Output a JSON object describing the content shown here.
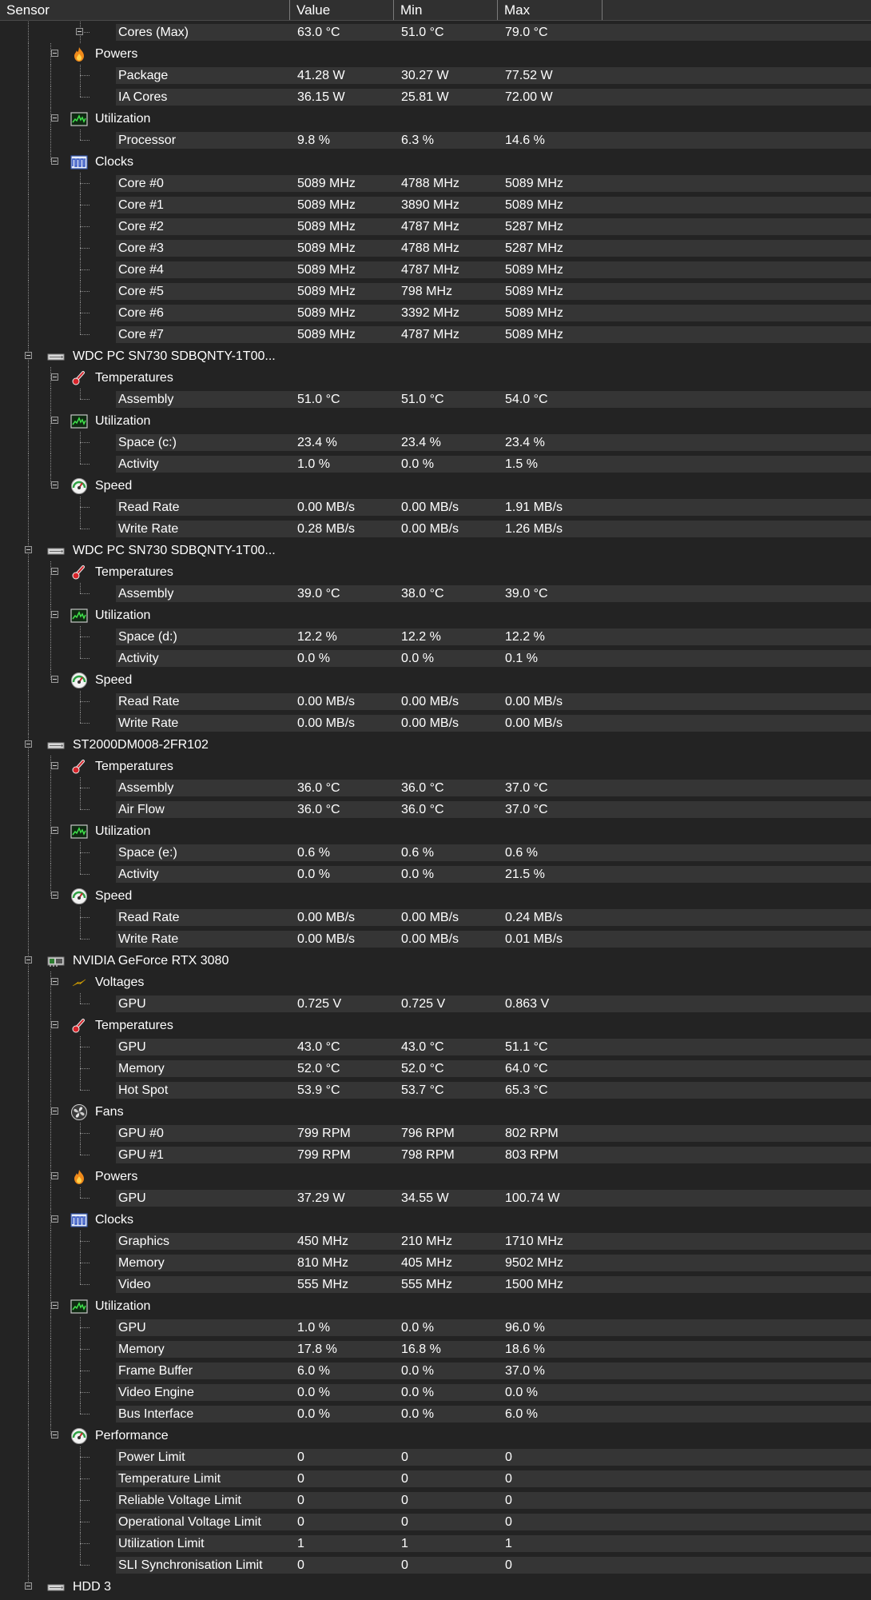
{
  "header": {
    "columns": [
      "Sensor",
      "Value",
      "Min",
      "Max"
    ]
  },
  "rows": [
    {
      "level": 3,
      "label": "Cores (Max)",
      "value": "63.0 °C",
      "min": "51.0 °C",
      "max": "79.0 °C",
      "box": true
    },
    {
      "level": 2,
      "label": "Powers",
      "icon": "flame",
      "last": false
    },
    {
      "level": 3,
      "label": "Package",
      "value": "41.28 W",
      "min": "30.27 W",
      "max": "77.52 W"
    },
    {
      "level": 3,
      "label": "IA Cores",
      "value": "36.15 W",
      "min": "25.81 W",
      "max": "72.00 W",
      "last": true
    },
    {
      "level": 2,
      "label": "Utilization",
      "icon": "util"
    },
    {
      "level": 3,
      "label": "Processor",
      "value": "9.8 %",
      "min": "6.3 %",
      "max": "14.6 %",
      "last": true
    },
    {
      "level": 2,
      "label": "Clocks",
      "icon": "clock",
      "last": true
    },
    {
      "level": 3,
      "label": "Core #0",
      "value": "5089 MHz",
      "min": "4788 MHz",
      "max": "5089 MHz"
    },
    {
      "level": 3,
      "label": "Core #1",
      "value": "5089 MHz",
      "min": "3890 MHz",
      "max": "5089 MHz"
    },
    {
      "level": 3,
      "label": "Core #2",
      "value": "5089 MHz",
      "min": "4787 MHz",
      "max": "5287 MHz"
    },
    {
      "level": 3,
      "label": "Core #3",
      "value": "5089 MHz",
      "min": "4788 MHz",
      "max": "5287 MHz"
    },
    {
      "level": 3,
      "label": "Core #4",
      "value": "5089 MHz",
      "min": "4787 MHz",
      "max": "5089 MHz"
    },
    {
      "level": 3,
      "label": "Core #5",
      "value": "5089 MHz",
      "min": "798 MHz",
      "max": "5089 MHz"
    },
    {
      "level": 3,
      "label": "Core #6",
      "value": "5089 MHz",
      "min": "3392 MHz",
      "max": "5089 MHz"
    },
    {
      "level": 3,
      "label": "Core #7",
      "value": "5089 MHz",
      "min": "4787 MHz",
      "max": "5089 MHz",
      "last": true
    },
    {
      "level": 1,
      "label": "WDC PC SN730 SDBQNTY-1T00...",
      "icon": "drive"
    },
    {
      "level": 2,
      "label": "Temperatures",
      "icon": "thermo"
    },
    {
      "level": 3,
      "label": "Assembly",
      "value": "51.0 °C",
      "min": "51.0 °C",
      "max": "54.0 °C",
      "last": true
    },
    {
      "level": 2,
      "label": "Utilization",
      "icon": "util"
    },
    {
      "level": 3,
      "label": "Space (c:)",
      "value": "23.4 %",
      "min": "23.4 %",
      "max": "23.4 %"
    },
    {
      "level": 3,
      "label": "Activity",
      "value": "1.0 %",
      "min": "0.0 %",
      "max": "1.5 %",
      "last": true
    },
    {
      "level": 2,
      "label": "Speed",
      "icon": "gauge",
      "last": true
    },
    {
      "level": 3,
      "label": "Read Rate",
      "value": "0.00 MB/s",
      "min": "0.00 MB/s",
      "max": "1.91 MB/s"
    },
    {
      "level": 3,
      "label": "Write Rate",
      "value": "0.28 MB/s",
      "min": "0.00 MB/s",
      "max": "1.26 MB/s",
      "last": true
    },
    {
      "level": 1,
      "label": "WDC PC SN730 SDBQNTY-1T00...",
      "icon": "drive"
    },
    {
      "level": 2,
      "label": "Temperatures",
      "icon": "thermo"
    },
    {
      "level": 3,
      "label": "Assembly",
      "value": "39.0 °C",
      "min": "38.0 °C",
      "max": "39.0 °C",
      "last": true
    },
    {
      "level": 2,
      "label": "Utilization",
      "icon": "util"
    },
    {
      "level": 3,
      "label": "Space (d:)",
      "value": "12.2 %",
      "min": "12.2 %",
      "max": "12.2 %"
    },
    {
      "level": 3,
      "label": "Activity",
      "value": "0.0 %",
      "min": "0.0 %",
      "max": "0.1 %",
      "last": true
    },
    {
      "level": 2,
      "label": "Speed",
      "icon": "gauge",
      "last": true
    },
    {
      "level": 3,
      "label": "Read Rate",
      "value": "0.00 MB/s",
      "min": "0.00 MB/s",
      "max": "0.00 MB/s"
    },
    {
      "level": 3,
      "label": "Write Rate",
      "value": "0.00 MB/s",
      "min": "0.00 MB/s",
      "max": "0.00 MB/s",
      "last": true
    },
    {
      "level": 1,
      "label": "ST2000DM008-2FR102",
      "icon": "drive"
    },
    {
      "level": 2,
      "label": "Temperatures",
      "icon": "thermo"
    },
    {
      "level": 3,
      "label": "Assembly",
      "value": "36.0 °C",
      "min": "36.0 °C",
      "max": "37.0 °C"
    },
    {
      "level": 3,
      "label": "Air Flow",
      "value": "36.0 °C",
      "min": "36.0 °C",
      "max": "37.0 °C",
      "last": true
    },
    {
      "level": 2,
      "label": "Utilization",
      "icon": "util"
    },
    {
      "level": 3,
      "label": "Space (e:)",
      "value": "0.6 %",
      "min": "0.6 %",
      "max": "0.6 %"
    },
    {
      "level": 3,
      "label": "Activity",
      "value": "0.0 %",
      "min": "0.0 %",
      "max": "21.5 %",
      "last": true
    },
    {
      "level": 2,
      "label": "Speed",
      "icon": "gauge",
      "last": true
    },
    {
      "level": 3,
      "label": "Read Rate",
      "value": "0.00 MB/s",
      "min": "0.00 MB/s",
      "max": "0.24 MB/s"
    },
    {
      "level": 3,
      "label": "Write Rate",
      "value": "0.00 MB/s",
      "min": "0.00 MB/s",
      "max": "0.01 MB/s",
      "last": true
    },
    {
      "level": 1,
      "label": "NVIDIA GeForce RTX 3080",
      "icon": "gpu"
    },
    {
      "level": 2,
      "label": "Voltages",
      "icon": "bolt"
    },
    {
      "level": 3,
      "label": "GPU",
      "value": "0.725 V",
      "min": "0.725 V",
      "max": "0.863 V",
      "last": true
    },
    {
      "level": 2,
      "label": "Temperatures",
      "icon": "thermo"
    },
    {
      "level": 3,
      "label": "GPU",
      "value": "43.0 °C",
      "min": "43.0 °C",
      "max": "51.1 °C"
    },
    {
      "level": 3,
      "label": "Memory",
      "value": "52.0 °C",
      "min": "52.0 °C",
      "max": "64.0 °C"
    },
    {
      "level": 3,
      "label": "Hot Spot",
      "value": "53.9 °C",
      "min": "53.7 °C",
      "max": "65.3 °C",
      "last": true
    },
    {
      "level": 2,
      "label": "Fans",
      "icon": "fan"
    },
    {
      "level": 3,
      "label": "GPU #0",
      "value": "799 RPM",
      "min": "796 RPM",
      "max": "802 RPM"
    },
    {
      "level": 3,
      "label": "GPU #1",
      "value": "799 RPM",
      "min": "798 RPM",
      "max": "803 RPM",
      "last": true
    },
    {
      "level": 2,
      "label": "Powers",
      "icon": "flame"
    },
    {
      "level": 3,
      "label": "GPU",
      "value": "37.29 W",
      "min": "34.55 W",
      "max": "100.74 W",
      "last": true
    },
    {
      "level": 2,
      "label": "Clocks",
      "icon": "clock"
    },
    {
      "level": 3,
      "label": "Graphics",
      "value": "450 MHz",
      "min": "210 MHz",
      "max": "1710 MHz"
    },
    {
      "level": 3,
      "label": "Memory",
      "value": "810 MHz",
      "min": "405 MHz",
      "max": "9502 MHz"
    },
    {
      "level": 3,
      "label": "Video",
      "value": "555 MHz",
      "min": "555 MHz",
      "max": "1500 MHz",
      "last": true
    },
    {
      "level": 2,
      "label": "Utilization",
      "icon": "util"
    },
    {
      "level": 3,
      "label": "GPU",
      "value": "1.0 %",
      "min": "0.0 %",
      "max": "96.0 %"
    },
    {
      "level": 3,
      "label": "Memory",
      "value": "17.8 %",
      "min": "16.8 %",
      "max": "18.6 %"
    },
    {
      "level": 3,
      "label": "Frame Buffer",
      "value": "6.0 %",
      "min": "0.0 %",
      "max": "37.0 %"
    },
    {
      "level": 3,
      "label": "Video Engine",
      "value": "0.0 %",
      "min": "0.0 %",
      "max": "0.0 %"
    },
    {
      "level": 3,
      "label": "Bus Interface",
      "value": "0.0 %",
      "min": "0.0 %",
      "max": "6.0 %",
      "last": true
    },
    {
      "level": 2,
      "label": "Performance",
      "icon": "gauge",
      "last": true
    },
    {
      "level": 3,
      "label": "Power Limit",
      "value": "0",
      "min": "0",
      "max": "0"
    },
    {
      "level": 3,
      "label": "Temperature Limit",
      "value": "0",
      "min": "0",
      "max": "0"
    },
    {
      "level": 3,
      "label": "Reliable Voltage Limit",
      "value": "0",
      "min": "0",
      "max": "0"
    },
    {
      "level": 3,
      "label": "Operational Voltage Limit",
      "value": "0",
      "min": "0",
      "max": "0"
    },
    {
      "level": 3,
      "label": "Utilization Limit",
      "value": "1",
      "min": "1",
      "max": "1"
    },
    {
      "level": 3,
      "label": "SLI Synchronisation Limit",
      "value": "0",
      "min": "0",
      "max": "0",
      "last": true
    },
    {
      "level": 1,
      "label": "HDD 3",
      "icon": "drive"
    }
  ]
}
